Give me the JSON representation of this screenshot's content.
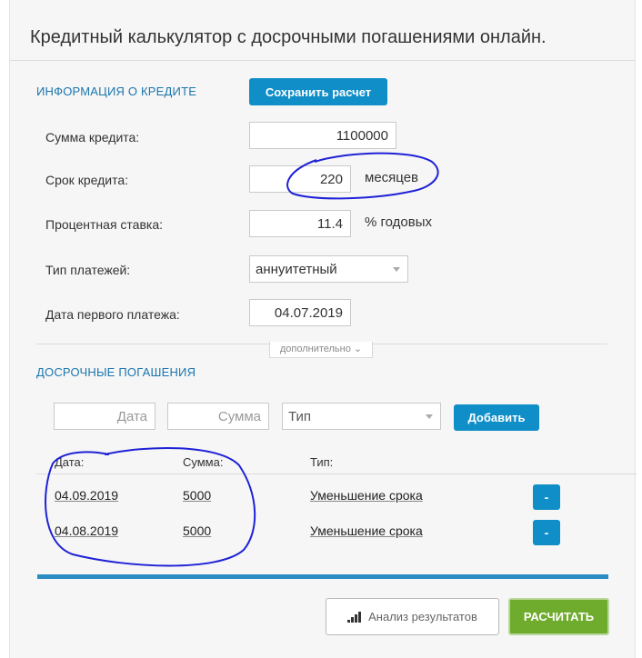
{
  "title": "Кредитный калькулятор с досрочными погашениями онлайн.",
  "credit_info": {
    "section_title": "ИНФОРМАЦИЯ О КРЕДИТЕ",
    "save_button": "Сохранить расчет",
    "amount": {
      "label": "Сумма кредита:",
      "value": "1100000"
    },
    "term": {
      "label": "Срок кредита:",
      "value": "220",
      "unit": "месяцев"
    },
    "rate": {
      "label": "Процентная ставка:",
      "value": "11.4",
      "unit": "% годовых"
    },
    "payment_type": {
      "label": "Тип платежей:",
      "value": "аннуитетный"
    },
    "first_payment": {
      "label": "Дата первого платежа:",
      "value": "04.07.2019"
    },
    "more_toggle": "дополнительно"
  },
  "early_repayments": {
    "section_title": "ДОСРОЧНЫЕ ПОГАШЕНИЯ",
    "date_placeholder": "Дата",
    "amount_placeholder": "Сумма",
    "type_placeholder": "Тип",
    "add_button": "Добавить",
    "columns": {
      "date": "Дата:",
      "amount": "Сумма:",
      "type": "Тип:"
    },
    "rows": [
      {
        "date": "04.09.2019",
        "amount": "5000",
        "type": "Уменьшение срока",
        "remove": "-"
      },
      {
        "date": "04.08.2019",
        "amount": "5000",
        "type": "Уменьшение срока",
        "remove": "-"
      }
    ]
  },
  "footer": {
    "analyze_button": "Анализ результатов",
    "analyze_icon": "bar-chart-icon",
    "calculate_button": "РАСЧИТАТЬ"
  },
  "colors": {
    "accent_blue": "#108ec8",
    "section_blue": "#1b76ae",
    "calculate_green": "#6fab2c",
    "annotation_ink": "#1e22d6"
  }
}
